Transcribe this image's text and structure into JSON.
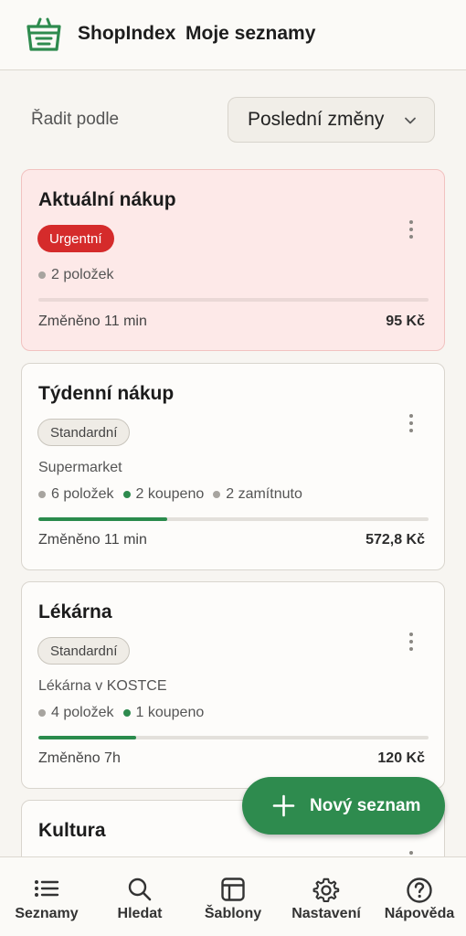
{
  "header": {
    "brand": "ShopIndex",
    "title": "Moje seznamy"
  },
  "sort": {
    "label": "Řadit podle",
    "selected": "Poslední změny"
  },
  "lists": [
    {
      "title": "Aktuální nákup",
      "badge": "Urgentní",
      "store": "",
      "stats": {
        "items": "2 položek"
      },
      "progress": 0,
      "changed": "Změněno 11 min",
      "price": "95 Kč"
    },
    {
      "title": "Týdenní nákup",
      "badge": "Standardní",
      "store": "Supermarket",
      "stats": {
        "items": "6 položek",
        "bought": "2 koupeno",
        "rejected": "2 zamítnuto"
      },
      "progress": 0.33,
      "changed": "Změněno 11 min",
      "price": "572,8 Kč"
    },
    {
      "title": "Lékárna",
      "badge": "Standardní",
      "store": "Lékárna v KOSTCE",
      "stats": {
        "items": "4 položek",
        "bought": "1 koupeno"
      },
      "progress": 0.25,
      "changed": "Změněno 7h",
      "price": "120 Kč"
    },
    {
      "title": "Kultura"
    }
  ],
  "fab": {
    "label": "Nový seznam"
  },
  "nav": [
    {
      "label": "Seznamy",
      "icon": "list-icon"
    },
    {
      "label": "Hledat",
      "icon": "search-icon"
    },
    {
      "label": "Šablony",
      "icon": "template-icon"
    },
    {
      "label": "Nastavení",
      "icon": "gear-icon"
    },
    {
      "label": "Nápověda",
      "icon": "help-icon"
    }
  ],
  "colors": {
    "accent": "#2e8b4e",
    "urgent": "#d52b2b",
    "urgent_card_bg": "#fde9e8",
    "background": "#f7f5f1"
  }
}
